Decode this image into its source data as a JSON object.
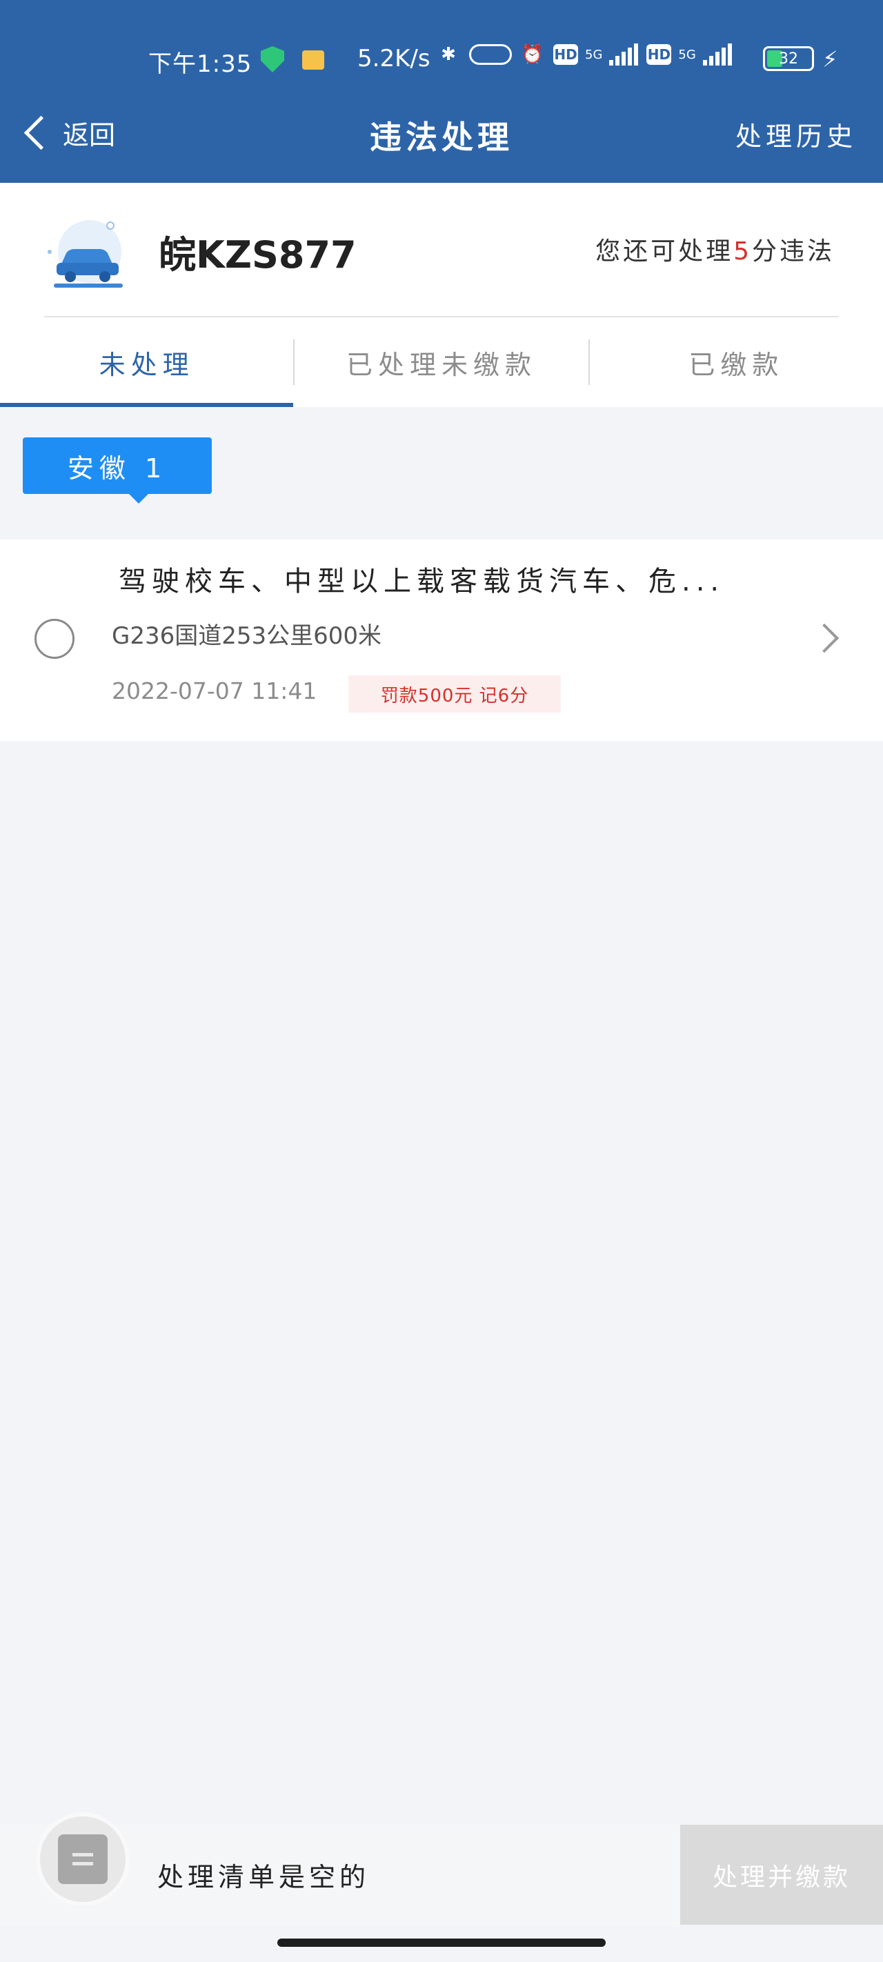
{
  "status_bar": {
    "time": "下午1:35",
    "net_speed": "5.2K/s",
    "hd1": "HD",
    "gen1": "5G",
    "hd2": "HD",
    "gen2": "5G",
    "battery": "32"
  },
  "nav": {
    "back_label": "返回",
    "title": "违法处理",
    "history_label": "处理历史"
  },
  "vehicle": {
    "plate": "皖KZS877",
    "quota_prefix": "您还可处理",
    "quota_number": "5",
    "quota_suffix": "分违法"
  },
  "tabs": [
    {
      "label": "未处理",
      "active": true
    },
    {
      "label": "已处理未缴款",
      "active": false
    },
    {
      "label": "已缴款",
      "active": false
    }
  ],
  "region_tag": "安徽 1",
  "violations": [
    {
      "title": "驾驶校车、中型以上载客载货汽车、危...",
      "location": "G236国道253公里600米",
      "time": "2022-07-07 11:41",
      "penalty": "罚款500元 记6分"
    }
  ],
  "bottom": {
    "empty_text": "处理清单是空的",
    "pay_label": "处理并缴款"
  },
  "colors": {
    "primary": "#2d64a8",
    "accent": "#1e8ef5",
    "alert": "#d6302b"
  }
}
